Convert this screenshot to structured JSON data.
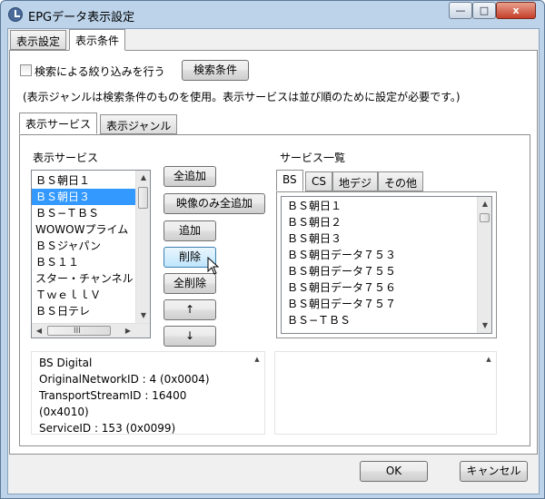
{
  "window": {
    "title": "EPGデータ表示設定",
    "minimize": "—",
    "maximize": "□",
    "close": "x"
  },
  "main_tabs": [
    "表示設定",
    "表示条件"
  ],
  "filter": {
    "checkbox_label": "検索による絞り込みを行う",
    "checked": false,
    "button": "検索条件"
  },
  "note": "(表示ジャンルは検索条件のものを使用。表示サービスは並び順のために設定が必要です。)",
  "sub_tabs": [
    "表示サービス",
    "表示ジャンル"
  ],
  "display_services": {
    "label": "表示サービス",
    "items": [
      "ＢＳ朝日１",
      "ＢＳ朝日３",
      "ＢＳ−ＴＢＳ",
      "WOWOWプライム",
      "ＢＳジャパン",
      "ＢＳ１１",
      "スター・チャンネル",
      "ＴｗｅｌｌＶ",
      "ＢＳ日テレ"
    ],
    "selected_index": 1
  },
  "buttons": {
    "add_all": "全追加",
    "add_video_only": "映像のみ全追加",
    "add": "追加",
    "delete": "削除",
    "delete_all": "全削除",
    "up": "↑",
    "down": "↓"
  },
  "service_list": {
    "label": "サービス一覧",
    "tabs": [
      "BS",
      "CS",
      "地デジ",
      "その他"
    ],
    "active_tab": "BS",
    "items": [
      "ＢＳ朝日１",
      "ＢＳ朝日２",
      "ＢＳ朝日３",
      "ＢＳ朝日データ７５３",
      "ＢＳ朝日データ７５５",
      "ＢＳ朝日データ７５６",
      "ＢＳ朝日データ７５７",
      "ＢＳ−ＴＢＳ"
    ]
  },
  "info": {
    "lines": [
      "BS Digital",
      "OriginalNetworkID : 4 (0x0004)",
      "TransportStreamID : 16400",
      "(0x4010)",
      "ServiceID : 153 (0x0099)"
    ]
  },
  "footer": {
    "ok": "OK",
    "cancel": "キャンセル"
  },
  "colors": {
    "title_bg": "#bcd3ea",
    "selection": "#3399ff",
    "hover_button": "#bee6fd"
  }
}
